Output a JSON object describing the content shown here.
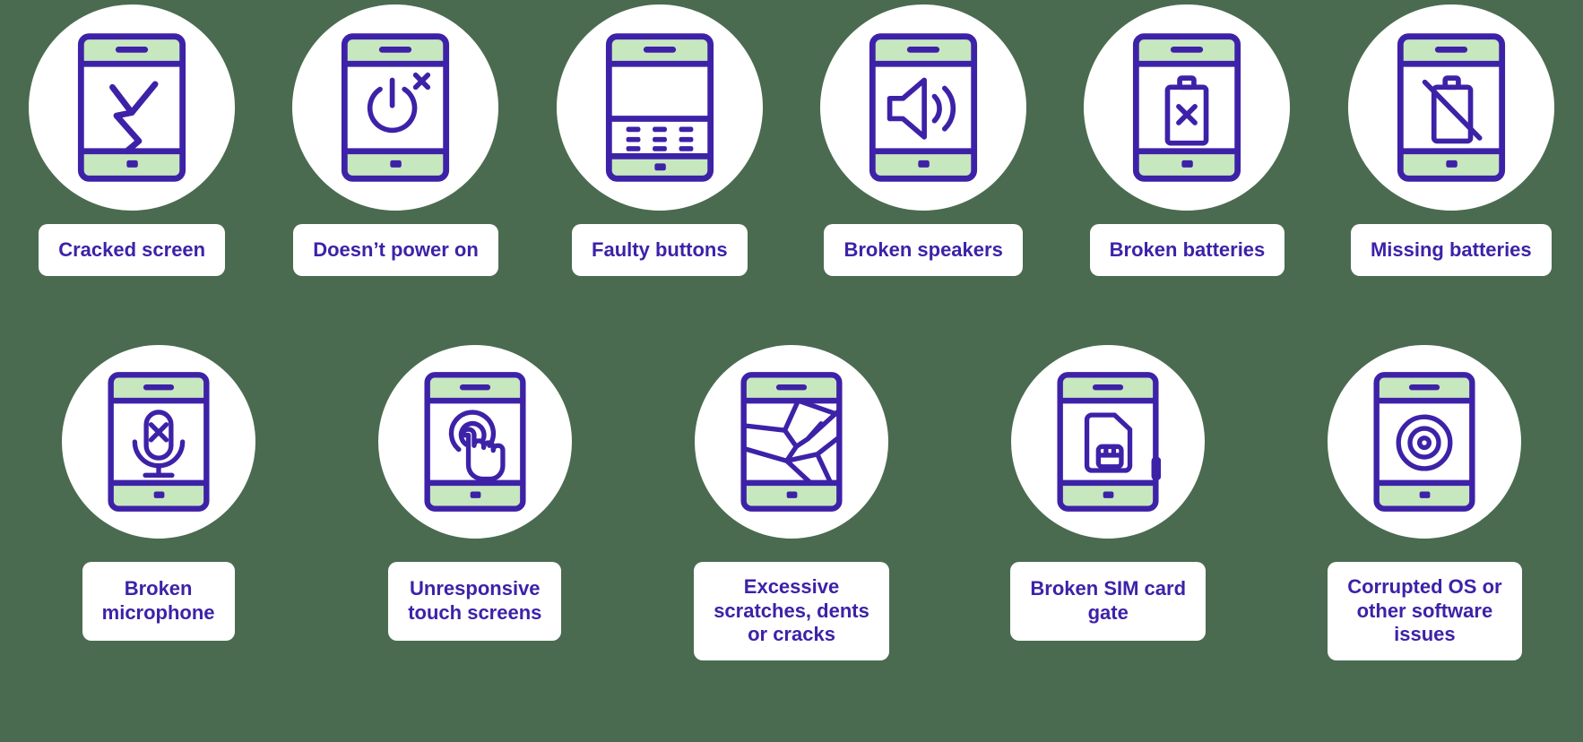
{
  "theme": {
    "background_color": "#4a6b4f",
    "circle_color": "#ffffff",
    "card_color": "#ffffff",
    "accent_purple": "#3d22a8",
    "accent_green": "#c7e7bf"
  },
  "rows": [
    {
      "row_index": 1,
      "items": [
        {
          "label": "Cracked screen",
          "icon": "phone-cracked-screen-icon"
        },
        {
          "label": "Doesn’t power on",
          "icon": "phone-power-off-icon"
        },
        {
          "label": "Faulty buttons",
          "icon": "phone-keypad-icon"
        },
        {
          "label": "Broken speakers",
          "icon": "phone-speaker-icon"
        },
        {
          "label": "Broken batteries",
          "icon": "phone-battery-x-icon"
        },
        {
          "label": "Missing batteries",
          "icon": "phone-battery-slash-icon"
        }
      ]
    },
    {
      "row_index": 2,
      "items": [
        {
          "label": "Broken\nmicrophone",
          "icon": "phone-microphone-x-icon",
          "lines": 2
        },
        {
          "label": "Unresponsive\ntouch screens",
          "icon": "phone-touch-icon",
          "lines": 2
        },
        {
          "label": "Excessive\nscratches, dents\nor cracks",
          "icon": "phone-shattered-icon",
          "lines": 3
        },
        {
          "label": "Broken SIM card\ngate",
          "icon": "phone-sim-card-icon",
          "lines": 2
        },
        {
          "label": "Corrupted OS or\nother software\nissues",
          "icon": "phone-disc-icon",
          "lines": 3
        }
      ]
    }
  ]
}
